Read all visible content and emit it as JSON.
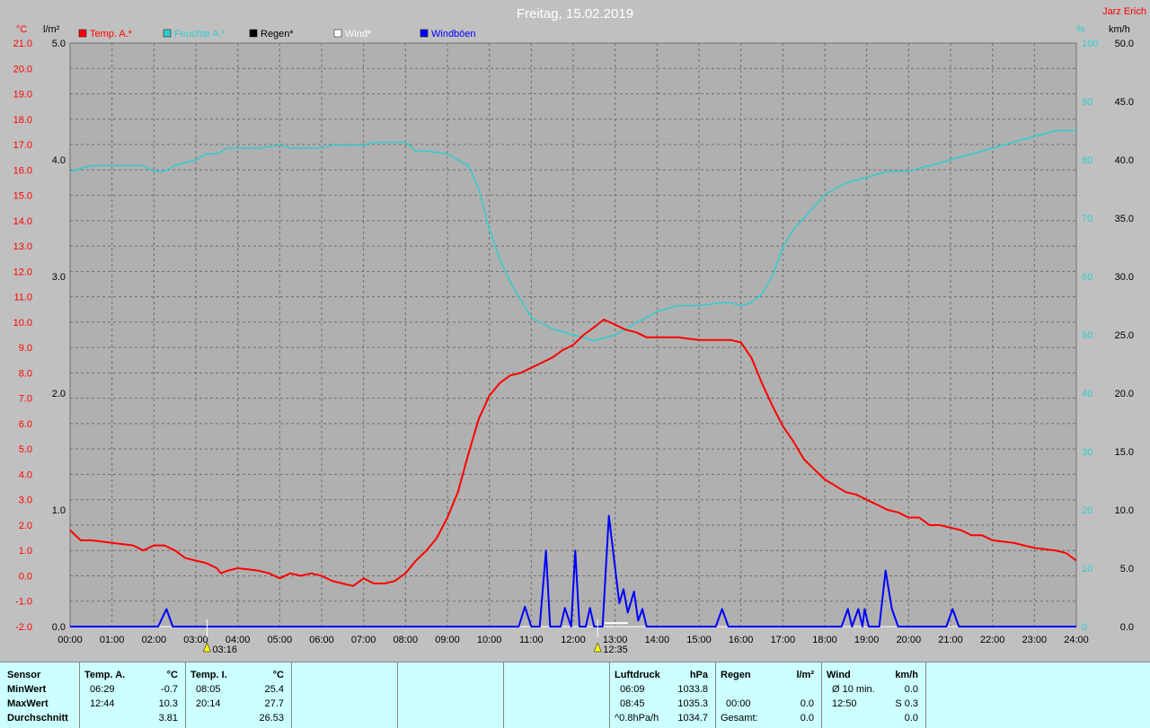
{
  "title": "Freitag, 15.02.2019",
  "author": "Jarz Erich",
  "colors": {
    "temp": "#ff0000",
    "humidity": "#33cccc",
    "rain": "#000000",
    "wind": "#ffffff",
    "gust": "#0000ff",
    "plot_bg": "#b0b0b0",
    "grid": "#6e6e6e",
    "stats_bg": "#ccffff"
  },
  "chart_data": {
    "type": "line",
    "legend": [
      {
        "label": "Temp. A.*",
        "color": "#ff0000"
      },
      {
        "label": "Feuchte A.*",
        "color": "#33cccc"
      },
      {
        "label": "Regen*",
        "color": "#000000"
      },
      {
        "label": "Wind*",
        "color": "#ffffff"
      },
      {
        "label": "Windböen",
        "color": "#0000ff"
      }
    ],
    "axes": {
      "temp": {
        "unit": "°C",
        "min": -2.0,
        "max": 21.0,
        "ticks": [
          "21.0",
          "20.0",
          "19.0",
          "18.0",
          "17.0",
          "16.0",
          "15.0",
          "14.0",
          "13.0",
          "12.0",
          "11.0",
          "10.0",
          "9.0",
          "8.0",
          "7.0",
          "6.0",
          "5.0",
          "4.0",
          "3.0",
          "2.0",
          "1.0",
          "0.0",
          "-1.0",
          "-2.0"
        ]
      },
      "rain": {
        "unit": "l/m²",
        "min": 0.0,
        "max": 5.0,
        "ticks": [
          "5.0",
          "4.0",
          "3.0",
          "2.0",
          "1.0",
          "0.0"
        ]
      },
      "humidity": {
        "unit": "%",
        "min": 0,
        "max": 100,
        "ticks": [
          "100",
          "90",
          "80",
          "70",
          "60",
          "50",
          "40",
          "30",
          "20",
          "10",
          "0"
        ]
      },
      "wind": {
        "unit": "km/h",
        "min": 0.0,
        "max": 50.0,
        "ticks": [
          "50.0",
          "45.0",
          "40.0",
          "35.0",
          "30.0",
          "25.0",
          "20.0",
          "15.0",
          "10.0",
          "5.0",
          "0.0"
        ]
      },
      "time": {
        "ticks": [
          "00:00",
          "01:00",
          "02:00",
          "03:00",
          "04:00",
          "05:00",
          "06:00",
          "07:00",
          "08:00",
          "09:00",
          "10:00",
          "11:00",
          "12:00",
          "13:00",
          "14:00",
          "15:00",
          "16:00",
          "17:00",
          "18:00",
          "19:00",
          "20:00",
          "21:00",
          "22:00",
          "23:00",
          "24:00"
        ]
      }
    },
    "markers": [
      {
        "time": "03:16",
        "label": "03:16"
      },
      {
        "time": "12:35",
        "label": "12:35"
      }
    ],
    "series": [
      {
        "name": "Temp. A.*",
        "axis": "temp",
        "points": [
          [
            0,
            1.8
          ],
          [
            0.25,
            1.4
          ],
          [
            0.5,
            1.4
          ],
          [
            1,
            1.3
          ],
          [
            1.5,
            1.2
          ],
          [
            1.75,
            1.0
          ],
          [
            2,
            1.2
          ],
          [
            2.25,
            1.2
          ],
          [
            2.5,
            1.0
          ],
          [
            2.75,
            0.7
          ],
          [
            3,
            0.6
          ],
          [
            3.25,
            0.5
          ],
          [
            3.5,
            0.3
          ],
          [
            3.6,
            0.1
          ],
          [
            3.75,
            0.2
          ],
          [
            4,
            0.3
          ],
          [
            4.5,
            0.2
          ],
          [
            4.75,
            0.1
          ],
          [
            5,
            -0.1
          ],
          [
            5.25,
            0.1
          ],
          [
            5.5,
            0.0
          ],
          [
            5.75,
            0.1
          ],
          [
            6,
            0.0
          ],
          [
            6.25,
            -0.2
          ],
          [
            6.5,
            -0.3
          ],
          [
            6.75,
            -0.4
          ],
          [
            7,
            -0.1
          ],
          [
            7.25,
            -0.3
          ],
          [
            7.5,
            -0.3
          ],
          [
            7.75,
            -0.2
          ],
          [
            8,
            0.1
          ],
          [
            8.25,
            0.6
          ],
          [
            8.5,
            1.0
          ],
          [
            8.75,
            1.5
          ],
          [
            9,
            2.3
          ],
          [
            9.25,
            3.3
          ],
          [
            9.5,
            4.8
          ],
          [
            9.75,
            6.2
          ],
          [
            10,
            7.1
          ],
          [
            10.25,
            7.6
          ],
          [
            10.5,
            7.9
          ],
          [
            10.75,
            8.0
          ],
          [
            11,
            8.2
          ],
          [
            11.25,
            8.4
          ],
          [
            11.5,
            8.6
          ],
          [
            11.75,
            8.9
          ],
          [
            12,
            9.1
          ],
          [
            12.25,
            9.5
          ],
          [
            12.5,
            9.8
          ],
          [
            12.73,
            10.1
          ],
          [
            13,
            9.9
          ],
          [
            13.25,
            9.7
          ],
          [
            13.5,
            9.6
          ],
          [
            13.75,
            9.4
          ],
          [
            14,
            9.4
          ],
          [
            14.5,
            9.4
          ],
          [
            15,
            9.3
          ],
          [
            15.5,
            9.3
          ],
          [
            15.75,
            9.3
          ],
          [
            16,
            9.2
          ],
          [
            16.25,
            8.6
          ],
          [
            16.5,
            7.6
          ],
          [
            16.75,
            6.7
          ],
          [
            17,
            5.9
          ],
          [
            17.25,
            5.3
          ],
          [
            17.5,
            4.6
          ],
          [
            17.75,
            4.2
          ],
          [
            18,
            3.8
          ],
          [
            18.5,
            3.3
          ],
          [
            18.75,
            3.2
          ],
          [
            19,
            3.0
          ],
          [
            19.5,
            2.6
          ],
          [
            19.75,
            2.5
          ],
          [
            20,
            2.3
          ],
          [
            20.25,
            2.3
          ],
          [
            20.5,
            2.0
          ],
          [
            20.75,
            2.0
          ],
          [
            21,
            1.9
          ],
          [
            21.25,
            1.8
          ],
          [
            21.5,
            1.6
          ],
          [
            21.75,
            1.6
          ],
          [
            22,
            1.4
          ],
          [
            22.5,
            1.3
          ],
          [
            22.75,
            1.2
          ],
          [
            23,
            1.1
          ],
          [
            23.5,
            1.0
          ],
          [
            23.75,
            0.9
          ],
          [
            24,
            0.6
          ]
        ]
      },
      {
        "name": "Feuchte A.*",
        "axis": "humidity",
        "points": [
          [
            0,
            78
          ],
          [
            0.5,
            79
          ],
          [
            1,
            79
          ],
          [
            1.5,
            79
          ],
          [
            1.75,
            79
          ],
          [
            2,
            78
          ],
          [
            2.25,
            78
          ],
          [
            2.5,
            79
          ],
          [
            3,
            80
          ],
          [
            3.25,
            81
          ],
          [
            3.5,
            81
          ],
          [
            3.75,
            82
          ],
          [
            4,
            82
          ],
          [
            4.25,
            82
          ],
          [
            4.5,
            82
          ],
          [
            5,
            82.5
          ],
          [
            5.25,
            82
          ],
          [
            5.5,
            82
          ],
          [
            6,
            82
          ],
          [
            6.25,
            82.5
          ],
          [
            6.5,
            82.5
          ],
          [
            7,
            82.5
          ],
          [
            7.25,
            83
          ],
          [
            7.5,
            83
          ],
          [
            8,
            83
          ],
          [
            8.25,
            81.5
          ],
          [
            8.5,
            81.5
          ],
          [
            9,
            81
          ],
          [
            9.5,
            79
          ],
          [
            9.75,
            75
          ],
          [
            10,
            68
          ],
          [
            10.25,
            63
          ],
          [
            10.5,
            59
          ],
          [
            10.75,
            56
          ],
          [
            11,
            53
          ],
          [
            11.5,
            51
          ],
          [
            12,
            50
          ],
          [
            12.5,
            49
          ],
          [
            13,
            50
          ],
          [
            13.25,
            51
          ],
          [
            13.5,
            52
          ],
          [
            13.75,
            53
          ],
          [
            14,
            54
          ],
          [
            14.5,
            55
          ],
          [
            15,
            55
          ],
          [
            15.5,
            55.5
          ],
          [
            15.75,
            55.5
          ],
          [
            16,
            55
          ],
          [
            16.25,
            55.5
          ],
          [
            16.5,
            57
          ],
          [
            16.75,
            60
          ],
          [
            17,
            65
          ],
          [
            17.25,
            68
          ],
          [
            17.5,
            70
          ],
          [
            17.75,
            72
          ],
          [
            18,
            74
          ],
          [
            18.5,
            76
          ],
          [
            19,
            77
          ],
          [
            19.5,
            78
          ],
          [
            20,
            78
          ],
          [
            20.5,
            79
          ],
          [
            21,
            80
          ],
          [
            21.5,
            81
          ],
          [
            22,
            82
          ],
          [
            22.5,
            83
          ],
          [
            23,
            84
          ],
          [
            23.5,
            85
          ],
          [
            24,
            85
          ]
        ]
      },
      {
        "name": "Windböen",
        "axis": "wind",
        "points": [
          [
            0,
            0
          ],
          [
            2.1,
            0
          ],
          [
            2.3,
            1.5
          ],
          [
            2.45,
            0
          ],
          [
            10.7,
            0
          ],
          [
            10.85,
            1.7
          ],
          [
            11.0,
            0
          ],
          [
            11.2,
            0
          ],
          [
            11.35,
            6.5
          ],
          [
            11.45,
            0
          ],
          [
            11.7,
            0
          ],
          [
            11.8,
            1.6
          ],
          [
            11.95,
            0
          ],
          [
            12.05,
            6.5
          ],
          [
            12.15,
            0
          ],
          [
            12.3,
            0
          ],
          [
            12.4,
            1.6
          ],
          [
            12.5,
            0
          ],
          [
            12.7,
            0
          ],
          [
            12.85,
            9.5
          ],
          [
            13.0,
            5.0
          ],
          [
            13.1,
            2.0
          ],
          [
            13.2,
            3.2
          ],
          [
            13.3,
            1.2
          ],
          [
            13.45,
            3.0
          ],
          [
            13.55,
            0.5
          ],
          [
            13.65,
            1.5
          ],
          [
            13.75,
            0
          ],
          [
            15.4,
            0
          ],
          [
            15.55,
            1.5
          ],
          [
            15.7,
            0
          ],
          [
            18.4,
            0
          ],
          [
            18.55,
            1.5
          ],
          [
            18.65,
            0
          ],
          [
            18.8,
            1.5
          ],
          [
            18.9,
            0
          ],
          [
            18.95,
            1.5
          ],
          [
            19.05,
            0
          ],
          [
            19.3,
            0
          ],
          [
            19.45,
            4.8
          ],
          [
            19.6,
            1.5
          ],
          [
            19.75,
            0
          ],
          [
            20.9,
            0
          ],
          [
            21.05,
            1.5
          ],
          [
            21.2,
            0
          ],
          [
            24,
            0
          ]
        ]
      },
      {
        "name": "Wind*",
        "axis": "wind",
        "points": [
          [
            12.75,
            0.3
          ],
          [
            13.3,
            0.3
          ]
        ]
      }
    ]
  },
  "stats": {
    "sensor": {
      "header": "Sensor",
      "rows": [
        "MinWert",
        "MaxWert",
        "Durchschnitt"
      ]
    },
    "temp_a": {
      "header": "Temp. A.",
      "unit": "°C",
      "min_time": "06:29",
      "min_val": "-0.7",
      "max_time": "12:44",
      "max_val": "10.3",
      "avg": "3.81"
    },
    "temp_i": {
      "header": "Temp. I.",
      "unit": "°C",
      "min_time": "08:05",
      "min_val": "25.4",
      "max_time": "20:14",
      "max_val": "27.7",
      "avg": "26.53"
    },
    "pressure": {
      "header": "Luftdruck",
      "unit": "hPa",
      "min_time": "06:09",
      "min_val": "1033.8",
      "max_time": "08:45",
      "max_val": "1035.3",
      "trend_label": "^0.8hPa/h",
      "trend_val": "1034.7"
    },
    "rain": {
      "header": "Regen",
      "unit": "l/m²",
      "time": "00:00",
      "val": "0.0",
      "total_label": "Gesamt:",
      "total_val": "0.0"
    },
    "wind": {
      "header": "Wind",
      "unit": "km/h",
      "avg_label": "Ø 10 min.",
      "avg_val": "0.0",
      "max_time": "12:50",
      "max_val": "S 0.3",
      "extra_val": "0.0"
    }
  }
}
